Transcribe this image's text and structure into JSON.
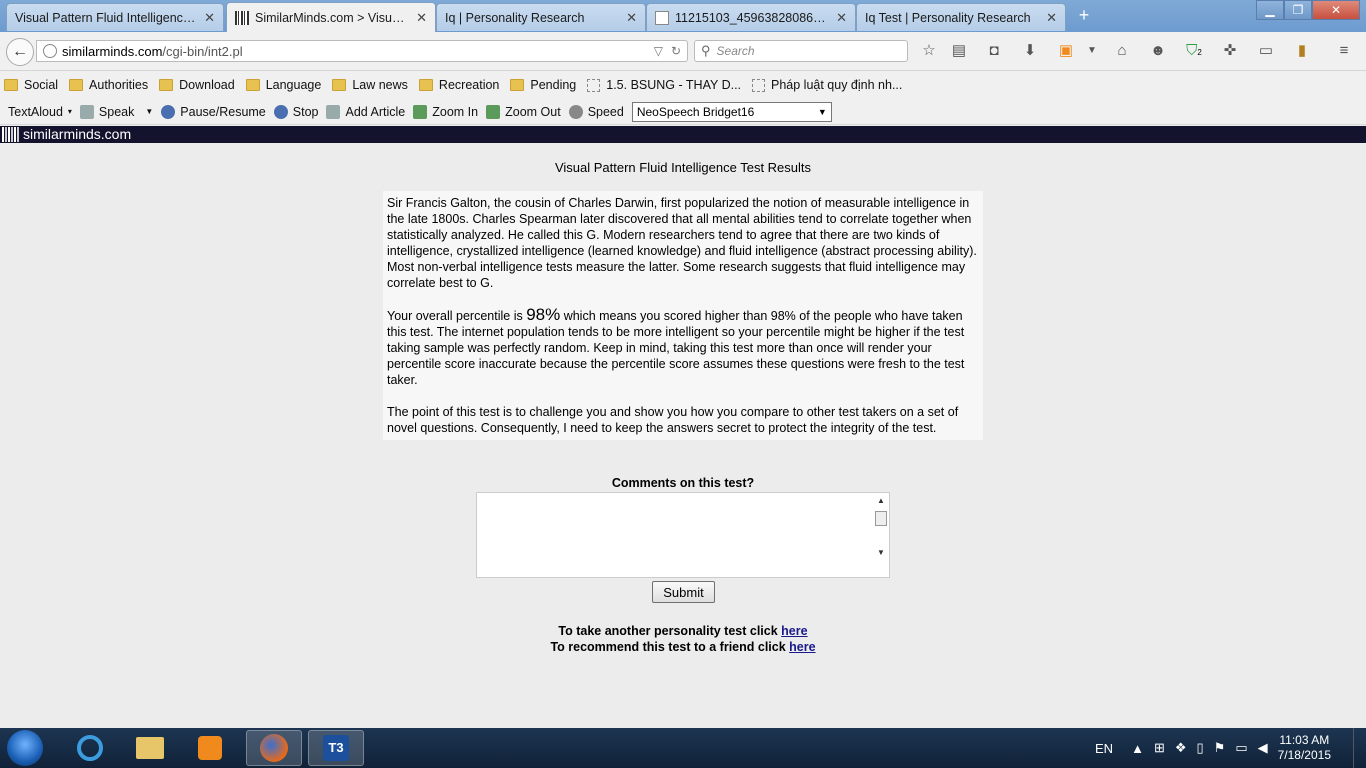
{
  "browser": {
    "tabs": [
      {
        "title": "Visual Pattern Fluid Intelligence..."
      },
      {
        "title": "SimilarMinds.com > Visual..."
      },
      {
        "title": "Iq | Personality Research"
      },
      {
        "title": "11215103_459638280864702..."
      },
      {
        "title": "Iq Test | Personality Research"
      }
    ],
    "url_host": "similarminds.com",
    "url_path": "/cgi-bin/int2.pl",
    "search_placeholder": "Search",
    "addon_badge": "2"
  },
  "bookmarks": [
    {
      "label": "Social",
      "icon": "folder"
    },
    {
      "label": "Authorities",
      "icon": "folder"
    },
    {
      "label": "Download",
      "icon": "folder"
    },
    {
      "label": "Language",
      "icon": "folder"
    },
    {
      "label": "Law news",
      "icon": "folder"
    },
    {
      "label": "Recreation",
      "icon": "folder"
    },
    {
      "label": "Pending",
      "icon": "folder"
    },
    {
      "label": "1.5. BSUNG - THAY D...",
      "icon": "page"
    },
    {
      "label": "Pháp luật quy định nh...",
      "icon": "page"
    }
  ],
  "textaloud": {
    "brand": "TextAloud",
    "speak": "Speak",
    "pause_resume": "Pause/Resume",
    "stop": "Stop",
    "add_article": "Add Article",
    "zoom_in": "Zoom In",
    "zoom_out": "Zoom Out",
    "speed": "Speed",
    "voice": "NeoSpeech Bridget16"
  },
  "site": {
    "name": "similarminds.com"
  },
  "page": {
    "title": "Visual Pattern Fluid Intelligence Test Results",
    "para1": "Sir Francis Galton, the cousin of Charles Darwin, first popularized the notion of measurable intelligence in the late 1800s. Charles Spearman later discovered that all mental abilities tend to correlate together when statistically analyzed. He called this G. Modern researchers tend to agree that there are two kinds of intelligence, crystallized intelligence (learned knowledge) and fluid intelligence (abstract processing ability). Most non-verbal intelligence tests measure the latter. Some research suggests that fluid intelligence may correlate best to G.",
    "percentile_prefix": "Your overall percentile is ",
    "percentile": "98%",
    "percentile_suffix": " which means you scored higher than 98% of the people who have taken this test. The internet population tends to be more intelligent so your percentile might be higher if the test taking sample was perfectly random. Keep in mind, taking this test more than once will render your percentile score inaccurate because the percentile score assumes these questions were fresh to the test taker.",
    "para3": "The point of this test is to challenge you and show you how you compare to other test takers on a set of novel questions. Consequently, I need to keep the answers secret to protect the integrity of the test.",
    "comments_label": "Comments on this test?",
    "comments_value": "",
    "submit_label": "Submit",
    "another_test_text": "To take another personality test click ",
    "recommend_text": "To recommend this test to a friend click ",
    "here_link": "here"
  },
  "taskbar": {
    "lang": "EN",
    "time": "11:03 AM",
    "date": "7/18/2015",
    "t3_label": "T3"
  }
}
